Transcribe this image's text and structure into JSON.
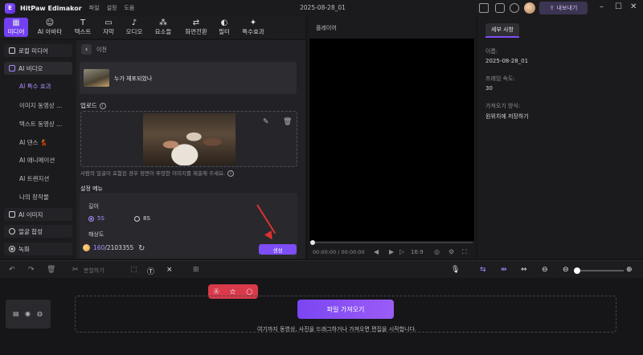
{
  "app": {
    "name": "HitPaw Edimakor",
    "logo_text": "E",
    "menu": [
      "파일",
      "설정",
      "도움"
    ],
    "document_title": "2025-08-28_01",
    "export_label": "내보내기"
  },
  "toolbar": {
    "tools": [
      {
        "label": "미디어",
        "icon": "▦"
      },
      {
        "label": "AI 아바타",
        "icon": "☺"
      },
      {
        "label": "텍스트",
        "icon": "T"
      },
      {
        "label": "자막",
        "icon": "▭"
      },
      {
        "label": "오디오",
        "icon": "♪"
      },
      {
        "label": "요소들",
        "icon": "⁂"
      },
      {
        "label": "화면전환",
        "icon": "⇄"
      },
      {
        "label": "필터",
        "icon": "◐"
      },
      {
        "label": "특수효과",
        "icon": "✦"
      }
    ]
  },
  "sidebar": {
    "local_media": "로컬 미디어",
    "ai_video": "AI 비디오",
    "sub_items": [
      "AI 특수 효과",
      "이미지 동영상 ...",
      "텍스트 동영상 ...",
      "AI 댄스 💃",
      "AI 애니메이션",
      "AI 트랜지션",
      "나의 창작물"
    ],
    "ai_image": "AI 이미지",
    "face_swap": "얼굴 합성",
    "recording": "녹화"
  },
  "panel": {
    "back_label": "이전",
    "template_label": "누가 체포되었나",
    "upload_label": "업로드",
    "hint": "사람의 얼굴이 포함된 경우 정면이 뚜렷한 이미지를 제출해 주세요.",
    "settings_title": "설정 메뉴",
    "length_label": "길이",
    "length_options": [
      "5S",
      "8S"
    ],
    "resolution_label": "해상도",
    "credits_used": "160",
    "credits_total": "/2103355",
    "generate_label": "생성"
  },
  "player": {
    "header": "플레이어",
    "timecode": "00:00:00 / 00:00:00",
    "ratio": "16:9"
  },
  "properties": {
    "tab": "세부 사항",
    "fields": [
      {
        "key": "이름:",
        "value": "2025-08-28_01"
      },
      {
        "key": "프레임 속도:",
        "value": "30"
      },
      {
        "key": "가져오기 방식:",
        "value": "원위치에 저장하기"
      }
    ]
  },
  "timeline": {
    "split_label": "분할하기",
    "import_label": "파일 가져오기",
    "import_hint": "여기까지 동영상, 사진을 드래그하거나 가져오면 편집을 시작합니다."
  },
  "colors": {
    "accent": "#7d4df5",
    "ai_bar": "#d83a4a",
    "annotation_arrow": "#e03030"
  }
}
